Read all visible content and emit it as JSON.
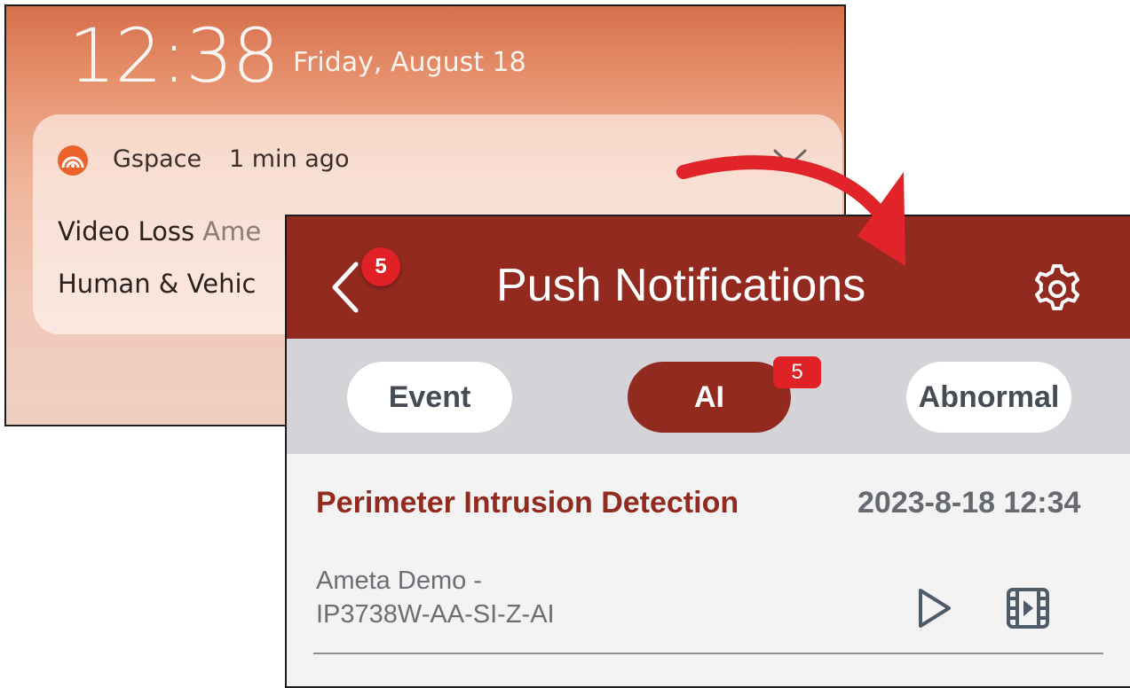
{
  "lock_screen": {
    "time": "12:38",
    "date": "Friday, August 18",
    "notification": {
      "icon": "gspace-app-icon",
      "app_name": "Gspace",
      "time_ago": "1 min ago",
      "line1_bold": "Video Loss",
      "line1_muted": "Ame",
      "line2": "Human & Vehic"
    }
  },
  "app": {
    "header": {
      "title": "Push Notifications",
      "back_badge": "5",
      "accent": "#922a20"
    },
    "tabs": [
      {
        "label": "Event",
        "active": false
      },
      {
        "label": "AI",
        "active": true,
        "badge": "5"
      },
      {
        "label": "Abnormal",
        "active": false
      }
    ],
    "event": {
      "title": "Perimeter Intrusion Detection",
      "time": "2023-8-18 12:34",
      "device_line1": "Ameta Demo -",
      "device_line2": "IP3738W-AA-SI-Z-AI",
      "icons": [
        "play-icon",
        "film-icon"
      ]
    }
  },
  "colors": {
    "badge": "#e02126",
    "arrow": "#e0242a"
  }
}
